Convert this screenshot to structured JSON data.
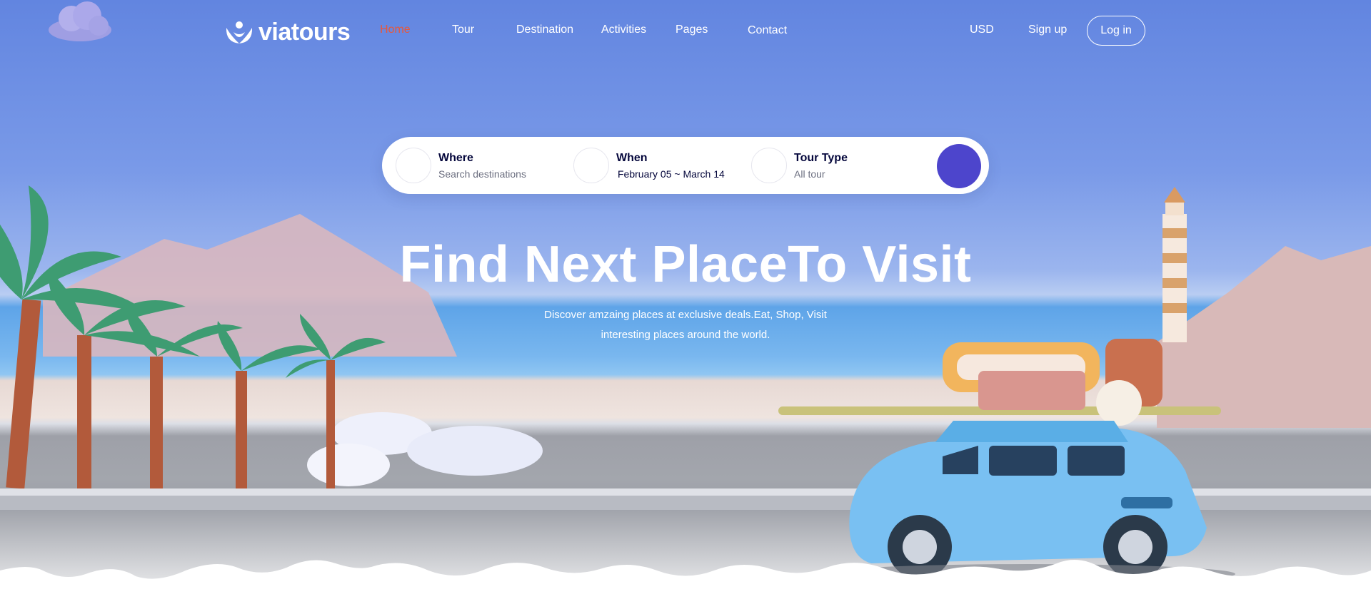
{
  "brand": {
    "name": "viatours"
  },
  "nav": {
    "links": [
      "Home",
      "Tour",
      "Destination",
      "Activities",
      "Pages",
      "Contact"
    ],
    "active_index": 0,
    "currency": "USD",
    "signup": "Sign up",
    "login": "Log in"
  },
  "search": {
    "where": {
      "label": "Where",
      "placeholder": "Search destinations",
      "icon": "location-pin-icon"
    },
    "when": {
      "label": "When",
      "value": "February 05 ~ March 14",
      "icon": "calendar-icon"
    },
    "tour_type": {
      "label": "Tour Type",
      "value": "All tour",
      "icon": "tour-icon"
    },
    "submit_icon": "search-icon"
  },
  "hero": {
    "title": "Find Next PlaceTo Visit",
    "subtitle": "Discover amzaing places at exclusive deals.Eat, Shop, Visit interesting places around the world."
  },
  "colors": {
    "accent": "#4d45cc",
    "active_link": "#e8573a",
    "dark_text": "#05073c"
  }
}
